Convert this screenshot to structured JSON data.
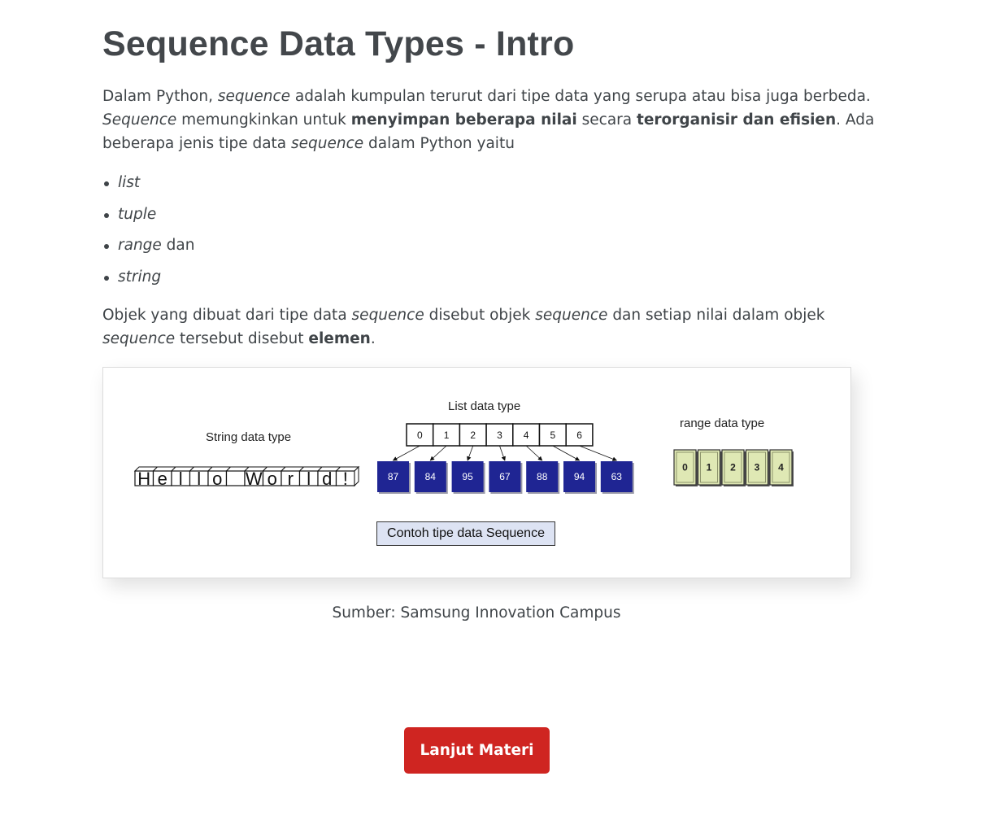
{
  "page": {
    "title": "Sequence Data Types - Intro"
  },
  "intro": {
    "s1": "Dalam Python, ",
    "s2": "sequence",
    "s3": " adalah kumpulan terurut dari tipe data yang serupa atau bisa juga berbeda.",
    "s4": "Sequence",
    "s5": " memungkinkan untuk ",
    "s6": "menyimpan beberapa nilai",
    "s7": " secara ",
    "s8": "terorganisir dan efisien",
    "s9": ". Ada",
    "s10": "beberapa jenis tipe data ",
    "s11": "sequence",
    "s12": " dalam Python yaitu"
  },
  "types_list": {
    "item1": "list",
    "item2": "tuple",
    "item3_em": "range",
    "item3_rest": " dan",
    "item4": "string"
  },
  "objects_para": {
    "s1": "Objek yang dibuat dari tipe data ",
    "s2": "sequence",
    "s3": " disebut objek ",
    "s4": "sequence",
    "s5": " dan setiap nilai dalam objek",
    "s6": "sequence",
    "s7": " tersebut disebut ",
    "s8": "elemen",
    "s9": "."
  },
  "figure": {
    "string_label": "String data type",
    "string_chars": [
      "H",
      "e",
      "l",
      "l",
      "o",
      " ",
      "W",
      "o",
      "r",
      "l",
      "d",
      "!"
    ],
    "list_label": "List data type",
    "list_indices": [
      "0",
      "1",
      "2",
      "3",
      "4",
      "5",
      "6"
    ],
    "list_values": [
      "87",
      "84",
      "95",
      "67",
      "88",
      "94",
      "63"
    ],
    "range_label": "range data type",
    "range_values": [
      "0",
      "1",
      "2",
      "3",
      "4"
    ],
    "caption": "Contoh tipe data Sequence",
    "colors": {
      "list_value_fill": "#1f2593",
      "range_fill": "#dfe8b4"
    }
  },
  "source": "Sumber: Samsung Innovation Campus",
  "cta": {
    "label": "Lanjut Materi",
    "color": "#cf2521"
  }
}
